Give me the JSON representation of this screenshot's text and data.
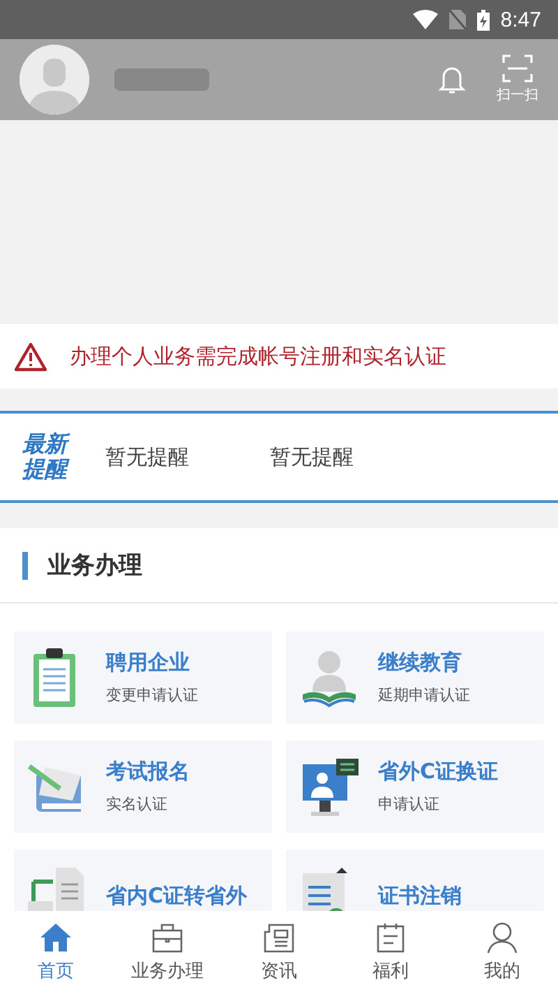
{
  "status_bar": {
    "time": "8:47"
  },
  "header": {
    "scan_label": "扫一扫"
  },
  "notice": {
    "text": "办理个人业务需完成帐号注册和实名认证"
  },
  "reminders": {
    "title": "最新提醒",
    "items": [
      "暂无提醒",
      "暂无提醒"
    ]
  },
  "section": {
    "title": "业务办理"
  },
  "services": [
    {
      "kind": "clipboard",
      "title": "聘用企业",
      "subtitle": "变更申请认证"
    },
    {
      "kind": "reader",
      "title": "继续教育",
      "subtitle": "延期申请认证"
    },
    {
      "kind": "book",
      "title": "考试报名",
      "subtitle": "实名认证"
    },
    {
      "kind": "monitor",
      "title": "省外C证换证",
      "subtitle": "申请认证"
    },
    {
      "kind": "documents",
      "title": "省内C证转省外"
    },
    {
      "kind": "certificate",
      "title": "证书注销"
    }
  ],
  "tabs": [
    {
      "kind": "home",
      "label": "首页",
      "selected": true
    },
    {
      "kind": "briefcase",
      "label": "业务办理",
      "selected": false
    },
    {
      "kind": "news",
      "label": "资讯",
      "selected": false
    },
    {
      "kind": "calendar",
      "label": "福利",
      "selected": false
    },
    {
      "kind": "person",
      "label": "我的",
      "selected": false
    }
  ]
}
